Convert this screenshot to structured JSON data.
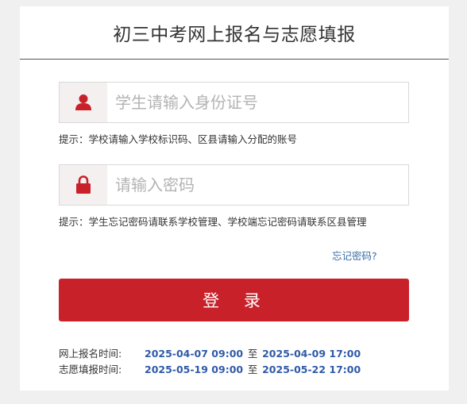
{
  "header": {
    "title": "初三中考网上报名与志愿填报"
  },
  "login": {
    "id_placeholder": "学生请输入身份证号",
    "id_hint": "提示：学校请输入学校标识码、区县请输入分配的账号",
    "pwd_placeholder": "请输入密码",
    "pwd_hint": "提示：学生忘记密码请联系学校管理、学校端忘记密码请联系区县管理",
    "forgot_label": "忘记密码?",
    "submit_label": "登 录"
  },
  "schedule": [
    {
      "label": "网上报名时间:",
      "start": "2025-04-07 09:00",
      "sep": "至",
      "end": "2025-04-09 17:00"
    },
    {
      "label": "志愿填报时间:",
      "start": "2025-05-19 09:00",
      "sep": "至",
      "end": "2025-05-22 17:00"
    }
  ],
  "colors": {
    "accent": "#c9212a",
    "link": "#3a6ea5",
    "date": "#2f5aa8",
    "icon_bg": "#f4f0f0"
  },
  "icons": {
    "id_field": "user-icon",
    "pwd_field": "lock-icon"
  }
}
